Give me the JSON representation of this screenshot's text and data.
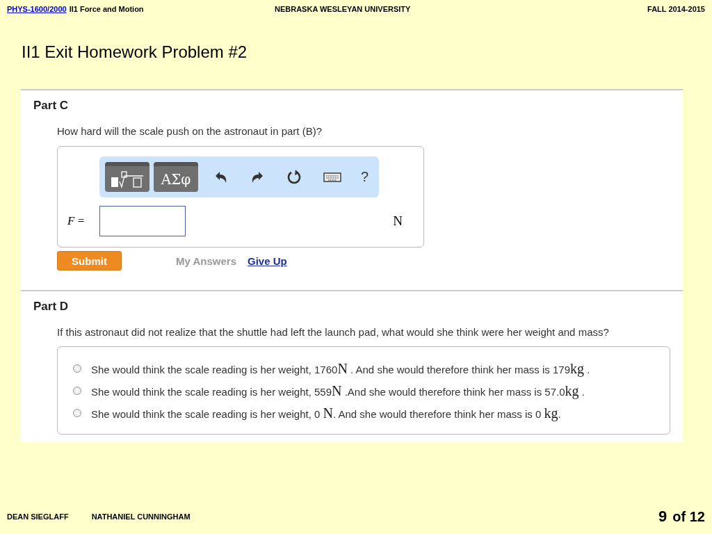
{
  "header": {
    "course_link": "PHYS-1600/2000",
    "course_title": "II1 Force and Motion",
    "university": "NEBRASKA WESLEYAN UNIVERSITY",
    "term": "FALL 2014-2015"
  },
  "title": "II1 Exit Homework Problem #2",
  "part_c": {
    "heading": "Part C",
    "question": "How hard will the scale push on the astronaut in part (B)?",
    "toolbar": [
      {
        "kind": "templates"
      },
      {
        "kind": "symbols",
        "label": "ΑΣφ"
      },
      {
        "kind": "undo"
      },
      {
        "kind": "redo"
      },
      {
        "kind": "reset"
      },
      {
        "kind": "keyboard"
      },
      {
        "kind": "help",
        "label": "?"
      }
    ],
    "variable": "F",
    "equals": "=",
    "unit": "N",
    "submit": "Submit",
    "my_answers": "My Answers",
    "give_up": "Give Up"
  },
  "part_d": {
    "heading": "Part D",
    "question": "If this astronaut did not realize that the shuttle had left the launch pad, what would she think were her weight and mass?",
    "options": [
      {
        "selected": false,
        "parts": [
          {
            "kind": "text",
            "text": "She would think the scale reading is her weight, 1760"
          },
          {
            "kind": "unit",
            "text": "N"
          },
          {
            "kind": "text",
            "text": " . And she would therefore think her mass is 179"
          },
          {
            "kind": "unit",
            "text": "kg"
          },
          {
            "kind": "text",
            "text": " ."
          }
        ]
      },
      {
        "selected": false,
        "parts": [
          {
            "kind": "text",
            "text": "She would think the scale reading is her weight, 559"
          },
          {
            "kind": "unit",
            "text": "N"
          },
          {
            "kind": "text",
            "text": " .And she would therefore think her mass is 57.0"
          },
          {
            "kind": "unit",
            "text": "kg"
          },
          {
            "kind": "text",
            "text": " ."
          }
        ]
      },
      {
        "selected": false,
        "parts": [
          {
            "kind": "text",
            "text": "She would think the scale reading is her weight, 0 "
          },
          {
            "kind": "unit",
            "text": "N"
          },
          {
            "kind": "text",
            "text": ". And she would therefore think her mass is 0 "
          },
          {
            "kind": "unit",
            "text": "kg"
          },
          {
            "kind": "text",
            "text": "."
          }
        ]
      }
    ]
  },
  "footer": {
    "authors": [
      "DEAN SIEGLAFF",
      "NATHANIEL CUNNINGHAM"
    ],
    "page": "9",
    "of": "of 12"
  }
}
